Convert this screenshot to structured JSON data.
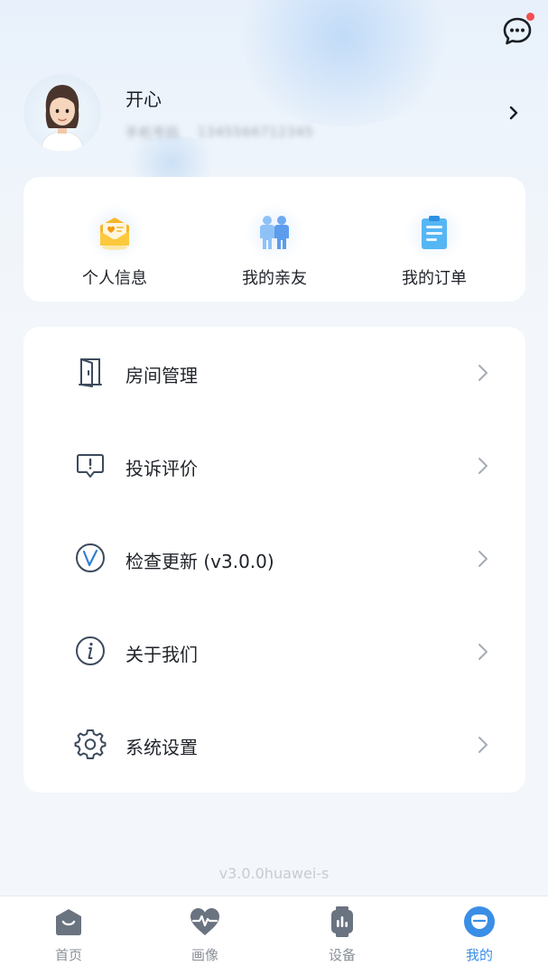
{
  "header": {
    "message_icon": "chat-bubble-icon",
    "has_notification": true
  },
  "profile": {
    "nickname": "开心",
    "blurred_line_1": "手机号码",
    "blurred_line_2": "1345566712345"
  },
  "quick_actions": [
    {
      "label": "个人信息",
      "icon": "personal-info-icon"
    },
    {
      "label": "我的亲友",
      "icon": "family-icon"
    },
    {
      "label": "我的订单",
      "icon": "order-icon"
    }
  ],
  "menu": [
    {
      "label": "房间管理",
      "icon": "door-icon"
    },
    {
      "label": "投诉评价",
      "icon": "complaint-icon"
    },
    {
      "label": "检查更新 (v3.0.0)",
      "icon": "update-icon"
    },
    {
      "label": "关于我们",
      "icon": "info-icon"
    },
    {
      "label": "系统设置",
      "icon": "gear-icon"
    }
  ],
  "version": "v3.0.0huawei-s",
  "tabs": [
    {
      "label": "首页",
      "icon": "home-icon",
      "active": false
    },
    {
      "label": "画像",
      "icon": "heart-pulse-icon",
      "active": false
    },
    {
      "label": "设备",
      "icon": "watch-icon",
      "active": false
    },
    {
      "label": "我的",
      "icon": "profile-icon",
      "active": true
    }
  ],
  "colors": {
    "accent": "#3a8ee6",
    "notification_dot": "#f05050",
    "icon_stroke": "#3c4a5c"
  }
}
